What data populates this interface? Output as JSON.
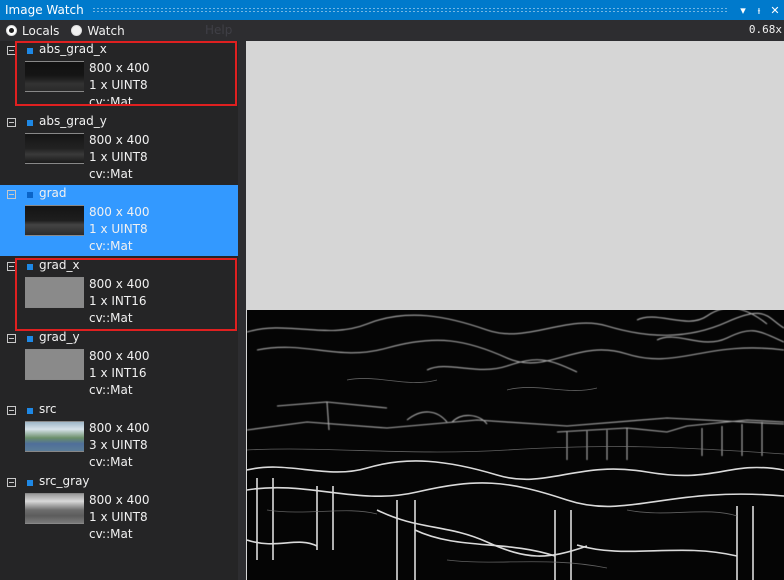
{
  "window": {
    "title": "Image Watch"
  },
  "toolbar": {
    "locals_label": "Locals",
    "watch_label": "Watch",
    "help_label": "Help",
    "zoom": "0.68x"
  },
  "items": [
    {
      "name": "abs_grad_x",
      "size": "800 x 400",
      "type": "1 x UINT8",
      "kind": "cv::Mat"
    },
    {
      "name": "abs_grad_y",
      "size": "800 x 400",
      "type": "1 x UINT8",
      "kind": "cv::Mat"
    },
    {
      "name": "grad",
      "size": "800 x 400",
      "type": "1 x UINT8",
      "kind": "cv::Mat"
    },
    {
      "name": "grad_x",
      "size": "800 x 400",
      "type": "1 x INT16",
      "kind": "cv::Mat"
    },
    {
      "name": "grad_y",
      "size": "800 x 400",
      "type": "1 x INT16",
      "kind": "cv::Mat"
    },
    {
      "name": "src",
      "size": "800 x 400",
      "type": "3 x UINT8",
      "kind": "cv::Mat"
    },
    {
      "name": "src_gray",
      "size": "800 x 400",
      "type": "1 x UINT8",
      "kind": "cv::Mat"
    }
  ],
  "selected_item": "grad",
  "highlighted_items": [
    "abs_grad_x",
    "grad_x"
  ],
  "colors": {
    "accent": "#007acc",
    "selection": "#3399ff",
    "highlight": "#e02020"
  }
}
